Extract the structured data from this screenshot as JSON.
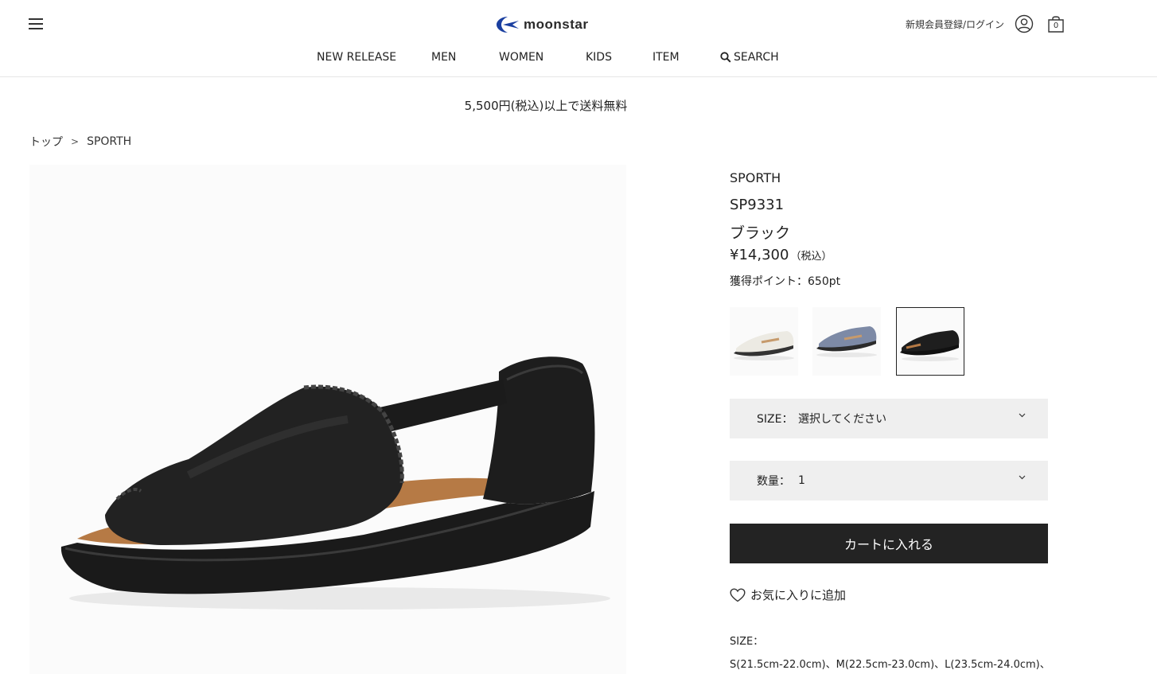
{
  "header": {
    "logo_text": "moonstar",
    "login_label": "新規会員登録/ログイン",
    "cart_count": "0",
    "icons": [
      "menu-icon",
      "moonstar-logo-icon",
      "user-icon",
      "cart-bag-icon"
    ]
  },
  "nav": {
    "items": [
      {
        "label": "NEW RELEASE"
      },
      {
        "label": "MEN"
      },
      {
        "label": "WOMEN"
      },
      {
        "label": "KIDS"
      },
      {
        "label": "ITEM"
      },
      {
        "label": "SEARCH",
        "icon": "search-icon"
      }
    ]
  },
  "banner": {
    "text": "5,500円(税込)以上で送料無料"
  },
  "breadcrumb": {
    "items": [
      "トップ",
      "SPORTH"
    ],
    "separator": ">"
  },
  "product": {
    "brand": "SPORTH",
    "code": "SP9331",
    "color": "ブラック",
    "price": "¥14,300",
    "tax_label": "（税込）",
    "points_label": "獲得ポイント：650pt",
    "variants": [
      {
        "color": "white",
        "hex": "#eceae3"
      },
      {
        "color": "blue-gray",
        "hex": "#7d8aa6"
      },
      {
        "color": "black",
        "hex": "#1e1e1e",
        "selected": true
      }
    ]
  },
  "size_select": {
    "label": "SIZE：",
    "value": "選択してください"
  },
  "quantity_select": {
    "label": "数量：",
    "value": "1"
  },
  "cart_button": {
    "label": "カートに入れる"
  },
  "favorite": {
    "label": "お気に入りに追加"
  },
  "size_info": {
    "title": "SIZE：",
    "values": "S(21.5cm-22.0cm)、M(22.5cm-23.0cm)、L(23.5cm-24.0cm)、"
  },
  "colors": {
    "button_bg": "#232323",
    "select_bg": "#efefef",
    "logo_blue": "#1a3fa0"
  }
}
